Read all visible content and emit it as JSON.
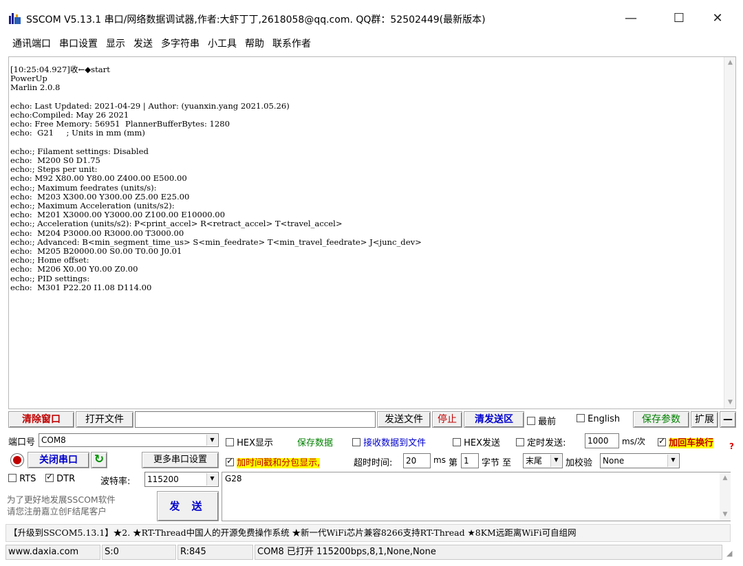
{
  "window": {
    "title": "SSCOM V5.13.1 串口/网络数据调试器,作者:大虾丁丁,2618058@qq.com. QQ群：52502449(最新版本)",
    "minimize": "—",
    "maximize": "☐",
    "close": "✕"
  },
  "menu": [
    "通讯端口",
    "串口设置",
    "显示",
    "发送",
    "多字符串",
    "小工具",
    "帮助",
    "联系作者"
  ],
  "receive": {
    "lines": [
      "[10:25:04.927]收←◆start",
      "PowerUp",
      "Marlin 2.0.8",
      "",
      "echo: Last Updated: 2021-04-29 | Author: (yuanxin.yang 2021.05.26)",
      "echo:Compiled: May 26 2021",
      "echo: Free Memory: 56951  PlannerBufferBytes: 1280",
      "echo:  G21     ; Units in mm (mm)",
      "",
      "echo:; Filament settings: Disabled",
      "echo:  M200 S0 D1.75",
      "echo:; Steps per unit:",
      "echo: M92 X80.00 Y80.00 Z400.00 E500.00",
      "echo:; Maximum feedrates (units/s):",
      "echo:  M203 X300.00 Y300.00 Z5.00 E25.00",
      "echo:; Maximum Acceleration (units/s2):",
      "echo:  M201 X3000.00 Y3000.00 Z100.00 E10000.00",
      "echo:; Acceleration (units/s2): P<print_accel> R<retract_accel> T<travel_accel>",
      "echo:  M204 P3000.00 R3000.00 T3000.00",
      "echo:; Advanced: B<min_segment_time_us> S<min_feedrate> T<min_travel_feedrate> J<junc_dev>",
      "echo:  M205 B20000.00 S0.00 T0.00 J0.01",
      "echo:; Home offset:",
      "echo:  M206 X0.00 Y0.00 Z0.00",
      "echo:; PID settings:",
      "echo:  M301 P22.20 I1.08 D114.00"
    ]
  },
  "toolbar1": {
    "clear_window": "清除窗口",
    "open_file": "打开文件",
    "send_file": "发送文件",
    "stop": "停止",
    "clear_send": "清发送区",
    "topmost": "最前",
    "english": "English",
    "save_params": "保存参数",
    "expand": "扩展",
    "collapse": "—"
  },
  "port": {
    "label": "端口号",
    "value": "COM8",
    "close_port": "关闭串口",
    "more_settings": "更多串口设置",
    "rts": "RTS",
    "dtr": "DTR",
    "baud_label": "波特率:",
    "baud_value": "115200",
    "promo": "为了更好地发展SSCOM软件\n请您注册嘉立创F结尾客户",
    "send_button": "发 送"
  },
  "options": {
    "hex_display": "HEX显示",
    "save_data": "保存数据",
    "recv_to_file": "接收数据到文件",
    "hex_send": "HEX发送",
    "timed_send": "定时发送:",
    "timed_value": "1000",
    "timed_unit": "ms/次",
    "add_crlf": "加回车换行",
    "timestamp": "加时间戳和分包显示,",
    "timeout_label": "超时时间:",
    "timeout_value": "20",
    "timeout_unit": "ms",
    "byte_label_1": "第",
    "byte_value": "1",
    "byte_label_2": "字节 至",
    "byte_end": "末尾",
    "checksum_label": "加校验",
    "checksum_value": "None"
  },
  "send_text": "G28",
  "marquee": "【升级到SSCOM5.13.1】★2.  ★RT-Thread中国人的开源免费操作系统 ★新一代WiFi芯片兼容8266支持RT-Thread ★8KM远距离WiFi可自组网",
  "status": {
    "website": "www.daxia.com",
    "sent": "S:0",
    "received": "R:845",
    "port_info": "COM8 已打开  115200bps,8,1,None,None"
  },
  "colors": {
    "accent_red": "#c00000",
    "accent_blue": "#0000cc",
    "accent_green": "#008000",
    "highlight_yellow": "#ffff00"
  }
}
